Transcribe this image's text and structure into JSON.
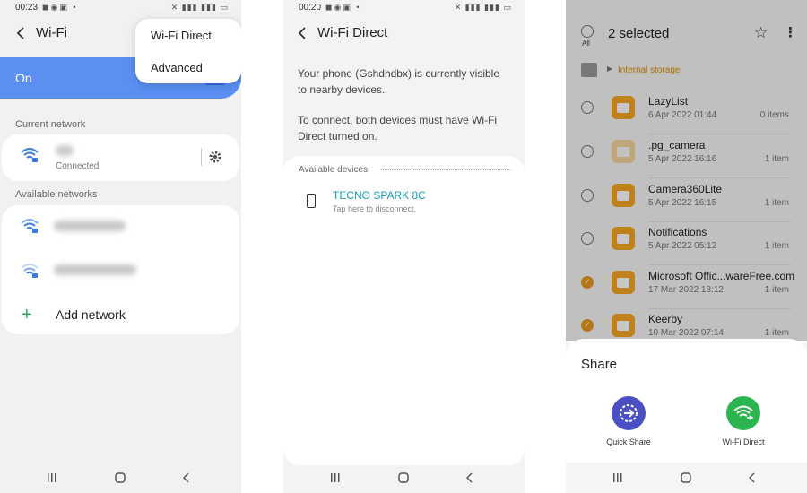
{
  "screen1": {
    "status_time": "00:23",
    "title": "Wi-Fi",
    "toggle_label": "On",
    "menu": [
      "Wi-Fi Direct",
      "Advanced"
    ],
    "current_network_label": "Current network",
    "connected_status": "Connected",
    "available_networks_label": "Available networks",
    "add_network_label": "Add network"
  },
  "screen2": {
    "status_time": "00:20",
    "title": "Wi-Fi Direct",
    "desc1": "Your phone (Gshdhdbx) is currently visible to nearby devices.",
    "desc2": "To connect, both devices must have Wi-Fi Direct turned on.",
    "available_devices_label": "Available devices",
    "device_name": "TECNO SPARK 8C",
    "device_hint": "Tap here to disconnect."
  },
  "screen3": {
    "all_label": "All",
    "selected_title": "2 selected",
    "storage_path": "Internal storage",
    "files": [
      {
        "name": "LazyList",
        "date": "6 Apr 2022 01:44",
        "count": "0 items",
        "checked": false,
        "faded": false
      },
      {
        "name": ".pg_camera",
        "date": "5 Apr 2022 16:16",
        "count": "1 item",
        "checked": false,
        "faded": true
      },
      {
        "name": "Camera360Lite",
        "date": "5 Apr 2022 16:15",
        "count": "1 item",
        "checked": false,
        "faded": false
      },
      {
        "name": "Notifications",
        "date": "5 Apr 2022 05:12",
        "count": "1 item",
        "checked": false,
        "faded": false
      },
      {
        "name": "Microsoft Offic...wareFree.com",
        "date": "17 Mar 2022 18:12",
        "count": "1 item",
        "checked": true,
        "faded": false
      },
      {
        "name": "Keerby",
        "date": "10 Mar 2022 07:14",
        "count": "1 item",
        "checked": true,
        "faded": false
      }
    ],
    "share_title": "Share",
    "share_targets": [
      "Quick Share",
      "Wi-Fi Direct"
    ]
  },
  "colors": {
    "toggle_blue": "#5b8ff2",
    "device_link": "#1a9bb3",
    "folder_orange": "#f5a623",
    "quick_share": "#4b4fc4",
    "wifi_direct_green": "#2bb550"
  }
}
